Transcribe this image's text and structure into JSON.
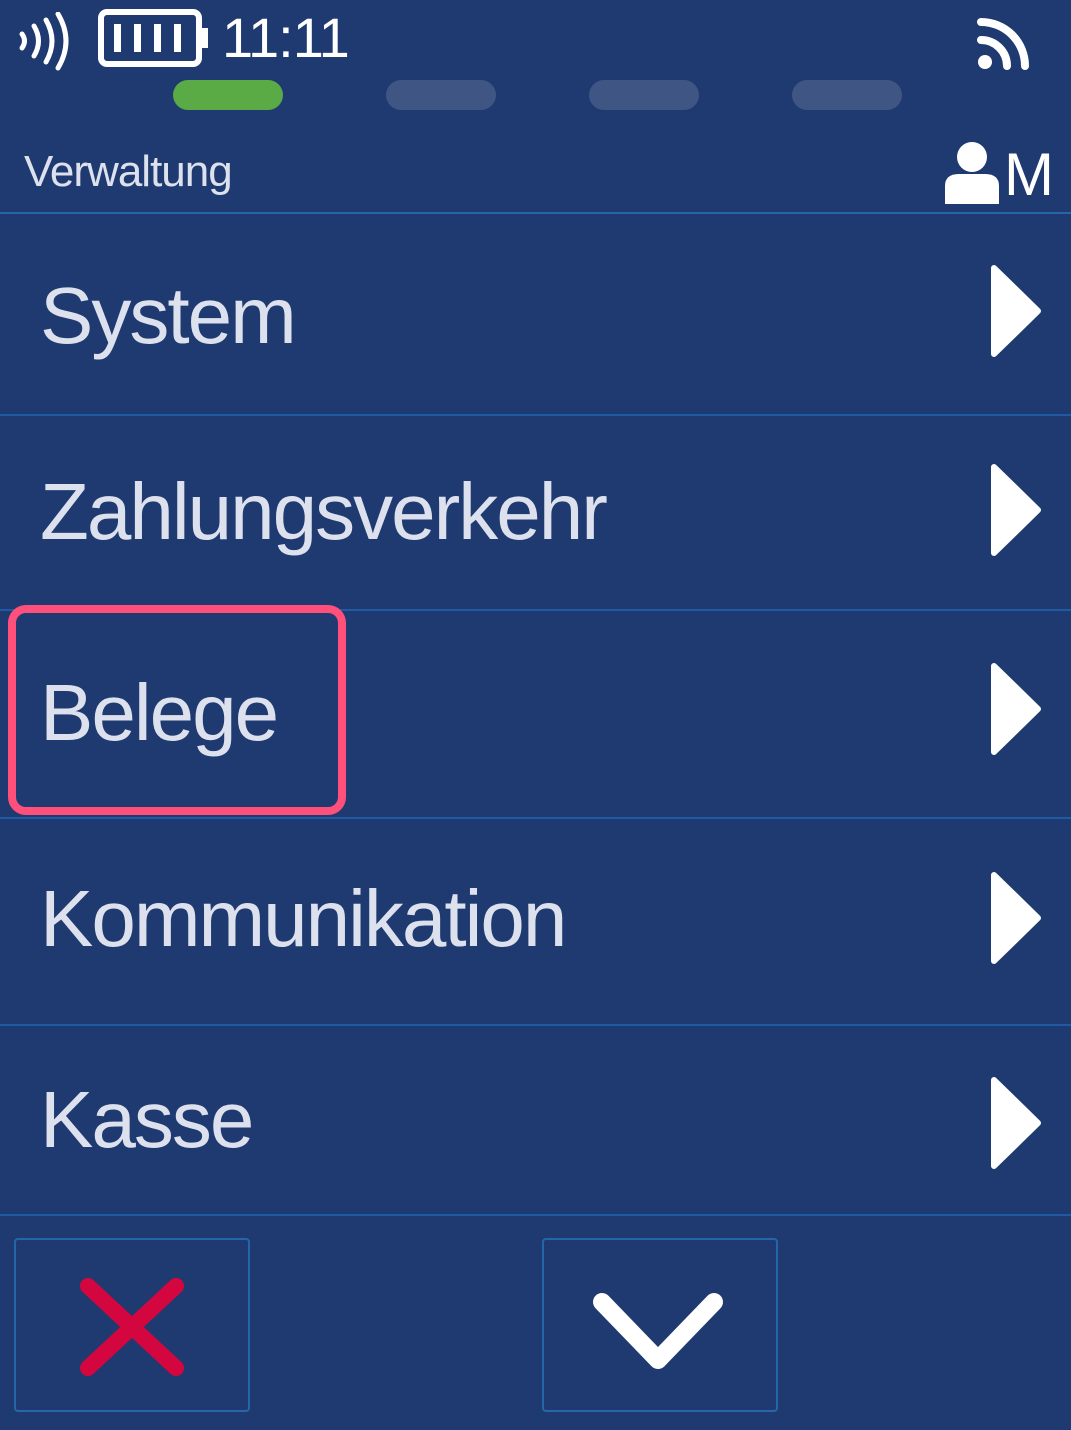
{
  "status": {
    "time": "11:11",
    "icons": [
      "nfc-contactless-icon",
      "battery-icon",
      "wifi-signal-icon"
    ]
  },
  "progress": {
    "steps": 4,
    "active_index": 0,
    "colors": {
      "active": "#5aab45",
      "inactive": "#3f5584"
    }
  },
  "header": {
    "title": "Verwaltung",
    "user_initial": "M",
    "user_icon": "user-icon"
  },
  "menu": {
    "items": [
      {
        "label": "System",
        "icon": "chevron-right-icon"
      },
      {
        "label": "Zahlungsverkehr",
        "icon": "chevron-right-icon"
      },
      {
        "label": "Belege",
        "icon": "chevron-right-icon",
        "highlighted": true
      },
      {
        "label": "Kommunikation",
        "icon": "chevron-right-icon"
      },
      {
        "label": "Kasse",
        "icon": "chevron-right-icon"
      }
    ]
  },
  "footer": {
    "cancel_icon": "close-x-icon",
    "scroll_icon": "chevron-down-icon"
  },
  "colors": {
    "background": "#1e3a70",
    "divider": "#1e5ba2",
    "text": "#dde1ee",
    "highlight": "#ff4f7b",
    "cancel": "#d4063f"
  }
}
